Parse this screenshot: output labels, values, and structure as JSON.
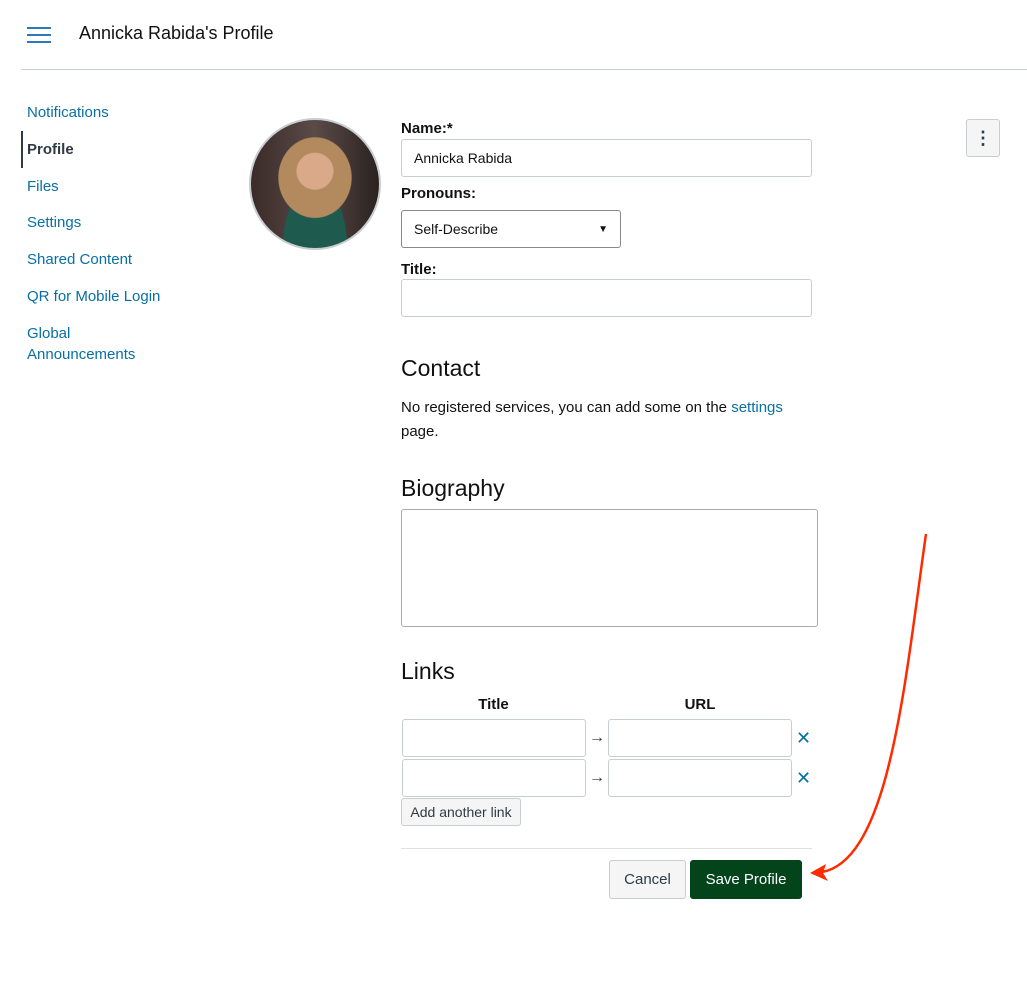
{
  "header": {
    "title": "Annicka Rabida's Profile",
    "menu_icon": "hamburger-icon"
  },
  "sidebar": {
    "items": [
      {
        "label": "Notifications"
      },
      {
        "label": "Profile",
        "active": true
      },
      {
        "label": "Files"
      },
      {
        "label": "Settings"
      },
      {
        "label": "Shared Content"
      },
      {
        "label": "QR for Mobile Login"
      },
      {
        "label": "Global Announcements"
      }
    ]
  },
  "form": {
    "name_label": "Name:*",
    "name_value": "Annicka Rabida",
    "pronouns_label": "Pronouns:",
    "pronouns_value": "Self-Describe",
    "title_label": "Title:",
    "title_value": "",
    "contact_heading": "Contact",
    "contact_text": "No registered services, you can add some on the ",
    "contact_link": "settings",
    "contact_text_end": "page.",
    "bio_heading": "Biography",
    "links_heading": "Links",
    "links_title_header": "Title",
    "links_url_header": "URL",
    "link_arrow": "→",
    "remove_icon": "✕",
    "add_link_label": "Add another link",
    "cancel_label": "Cancel",
    "save_label": "Save Profile"
  },
  "options_icon": "⋮",
  "colors": {
    "link": "#0770a3",
    "save_button": "#03441b",
    "annotation_arrow": "#ff2a00"
  }
}
